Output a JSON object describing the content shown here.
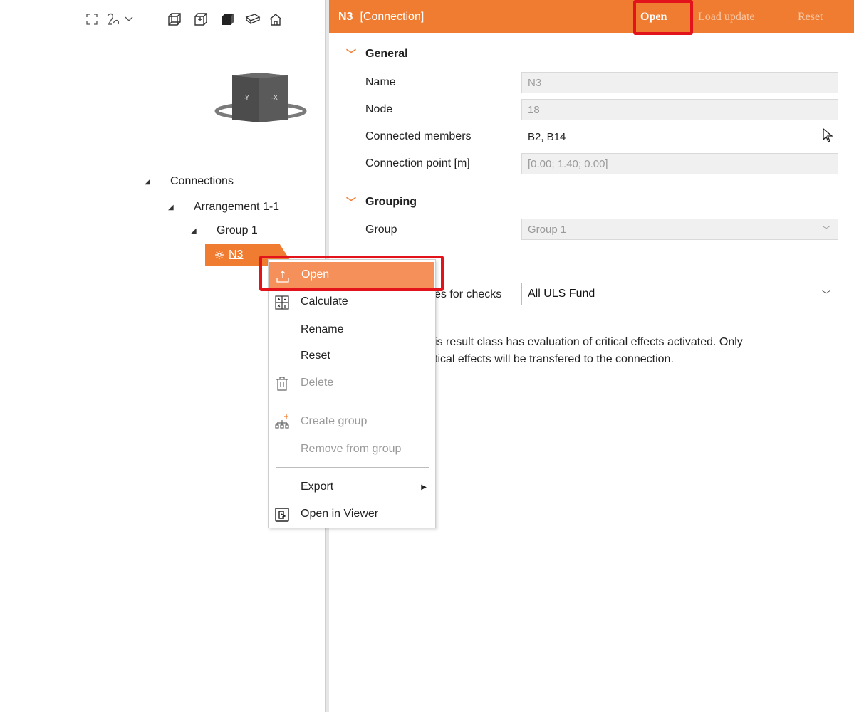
{
  "toolbar": {
    "icons": [
      "fit-view-icon",
      "rotate-icon",
      "dropdown-chevron-icon",
      "wireframe-view-icon",
      "wireframe-solid-view-icon",
      "solid-view-icon",
      "perspective-view-icon",
      "home-view-icon"
    ]
  },
  "view_cube": {
    "face_left": "-Y",
    "face_right": "-X"
  },
  "tree": {
    "root": "Connections",
    "arrangement": "Arrangement 1-1",
    "group": "Group 1",
    "node": "N3"
  },
  "header": {
    "name": "N3",
    "type": "[Connection]",
    "open_label": "Open",
    "load_update_label": "Load update",
    "reset_label": "Reset"
  },
  "general": {
    "title": "General",
    "name_label": "Name",
    "name_value": "N3",
    "node_label": "Node",
    "node_value": "18",
    "members_label": "Connected members",
    "members_value": "B2, B14",
    "point_label": "Connection point [m]",
    "point_value": "[0.00; 1.40; 0.00]"
  },
  "grouping": {
    "title": "Grouping",
    "group_label": "Group",
    "group_value": "Group 1"
  },
  "result_class": {
    "label_visible": "es for checks",
    "value": "All ULS Fund",
    "info_line1": "is result class has evaluation of critical effects activated. Only",
    "info_line2": "tical effects will be transfered to the connection."
  },
  "context_menu": {
    "open": "Open",
    "calculate": "Calculate",
    "rename": "Rename",
    "reset": "Reset",
    "delete": "Delete",
    "create_group": "Create group",
    "remove_from_group": "Remove from group",
    "export": "Export",
    "open_in_viewer": "Open in Viewer"
  },
  "colors": {
    "accent": "#f07c32",
    "menu_active": "#f5905a",
    "highlight_box": "#e3131b"
  }
}
